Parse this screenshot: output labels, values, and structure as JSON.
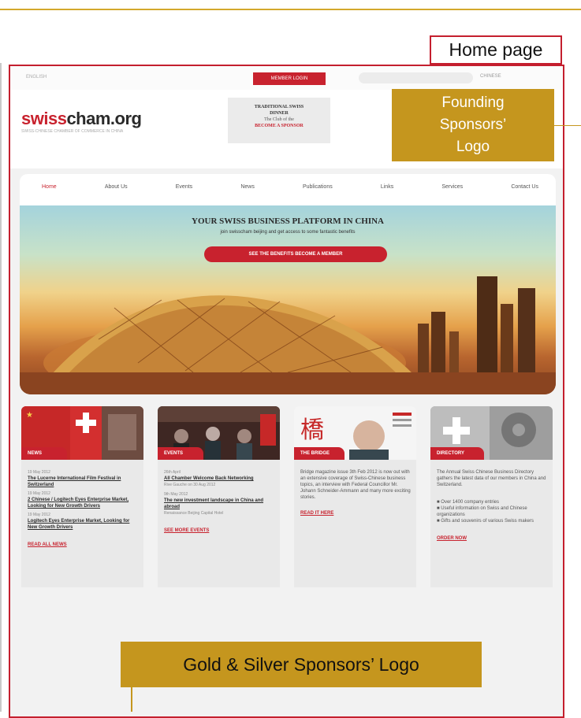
{
  "annotations": {
    "home_page_label": "Home page",
    "founding_sponsors": [
      "Founding",
      "Sponsors’",
      "Logo"
    ],
    "gold_silver_sponsors": "Gold & Silver Sponsors’ Logo"
  },
  "colors": {
    "accent_red": "#c8222e",
    "annotation_gold": "#c5961e",
    "frame_red": "#c41f2e"
  },
  "site": {
    "utility_left": "ENGLISH",
    "member_button": "MEMBER LOGIN",
    "utility_right": "CHINESE",
    "logo_part1": "swiss",
    "logo_part2": "cham.org",
    "logo_subtitle": "SWISS-CHINESE CHAMBER OF COMMERCE IN CHINA",
    "dinner": {
      "line1": "TRADITIONAL SWISS",
      "line2": "DINNER",
      "line3": "The Club of the",
      "line4": "BECOME A SPONSOR"
    },
    "nav": [
      "Home",
      "About Us",
      "Events",
      "News",
      "Publications",
      "Links",
      "Services",
      "Contact Us"
    ],
    "hero": {
      "title": "YOUR SWISS BUSINESS PLATFORM IN CHINA",
      "subtitle": "join swisscham beijing and get access to some fantastic benefits",
      "buttons": "SEE THE BENEFITS    BECOME A MEMBER"
    },
    "cards": [
      {
        "tag": "NEWS",
        "items": [
          {
            "date": "19 May 2012",
            "title": "The Lucerne International Film Festival in Switzerland"
          },
          {
            "date": "19 May 2012",
            "title": "2 Chinese / Logitech Eyes Enterprise Market, Looking for New Growth Drivers"
          },
          {
            "date": "19 May 2012",
            "title": "Logitech Eyes Enterprise Market, Looking for New Growth Drivers"
          }
        ],
        "more": "READ ALL NEWS"
      },
      {
        "tag": "EVENTS",
        "items": [
          {
            "date": "26th April",
            "title": "All Chamber Welcome Back Networking",
            "desc": "Rive Gauche on 30 Aug 2012"
          },
          {
            "date": "9th May 2012",
            "title": "The new investment landscape in China and abroad",
            "desc": "Renaissance Beijing Capital Hotel"
          }
        ],
        "more": "SEE MORE EVENTS"
      },
      {
        "tag": "THE BRIDGE",
        "body": "Bridge magazine issue 3th Feb 2012 is now out with an extensive coverage of Swiss-Chinese business topics, an interview with Federal Councillor Mr. Johann Schneider-Ammann and many more exciting stories.",
        "more": "READ IT HERE"
      },
      {
        "tag": "DIRECTORY",
        "body": "The Annual Swiss Chinese Business Directory gathers the latest data of our members in China and Switzerland.",
        "bullets": [
          "Over 1400 company entries",
          "Useful information on Swiss and Chinese organizations",
          "Gifts and souvenirs of various Swiss makers"
        ],
        "more": "ORDER NOW"
      }
    ]
  }
}
